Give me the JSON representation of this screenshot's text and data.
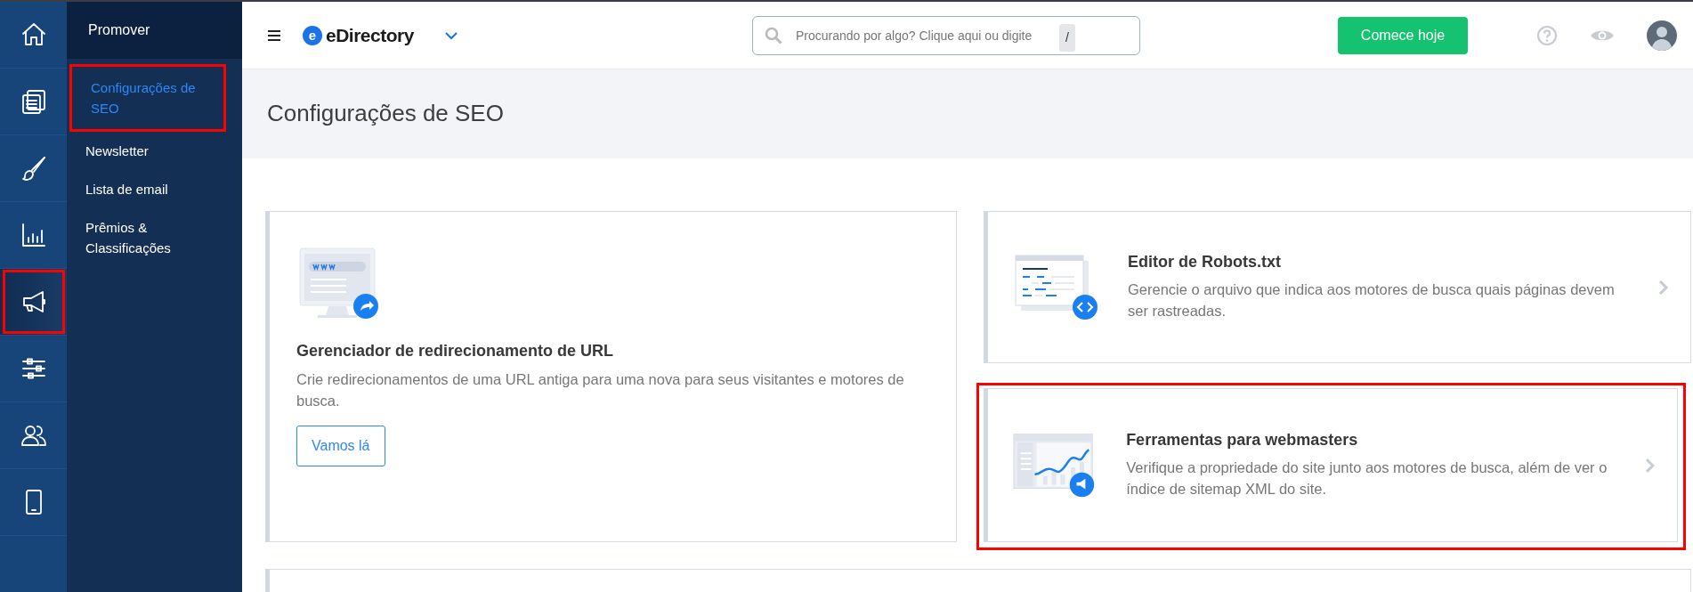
{
  "rail": [
    {
      "kind": "home",
      "selected": false,
      "highlighted": false
    },
    {
      "kind": "pages",
      "selected": false,
      "highlighted": false
    },
    {
      "kind": "brush",
      "selected": false,
      "highlighted": false
    },
    {
      "kind": "chart",
      "selected": false,
      "highlighted": false
    },
    {
      "kind": "megaphone",
      "selected": true,
      "highlighted": true
    },
    {
      "kind": "sliders",
      "selected": false,
      "highlighted": false
    },
    {
      "kind": "users",
      "selected": false,
      "highlighted": false
    },
    {
      "kind": "phone",
      "selected": false,
      "highlighted": false
    }
  ],
  "submenu": {
    "title": "Promover",
    "items": [
      {
        "label": "Configurações de SEO",
        "selected": true,
        "highlighted": true
      },
      {
        "label": "Newsletter",
        "selected": false,
        "highlighted": false
      },
      {
        "label": "Lista de email",
        "selected": false,
        "highlighted": false
      },
      {
        "label": "Prêmios & Classificações",
        "selected": false,
        "highlighted": false
      }
    ]
  },
  "topbar": {
    "brand_mark": "e",
    "brand": "eDirectory",
    "search": {
      "placeholder": "Procurando por algo? Clique aqui ou digite",
      "shortcut": "/"
    },
    "cta": "Comece hoje"
  },
  "page_title": "Configurações de SEO",
  "cards": [
    {
      "kind": "redirect",
      "title": "Gerenciador de redirecionamento de URL",
      "text": "Crie redirecionamentos de uma URL antiga para uma nova para seus visitantes e motores de busca.",
      "button": "Vamos lá",
      "highlighted": false
    },
    {
      "kind": "robots",
      "title": "Editor de Robots.txt",
      "text": "Gerencie o arquivo que indica aos motores de busca quais páginas devem ser rastreadas.",
      "highlighted": false
    },
    {
      "kind": "webmaster",
      "title": "Ferramentas para webmasters",
      "text": "Verifique a propriedade do site junto aos motores de busca, além de ver o índice de sitemap XML do site.",
      "highlighted": true
    }
  ]
}
